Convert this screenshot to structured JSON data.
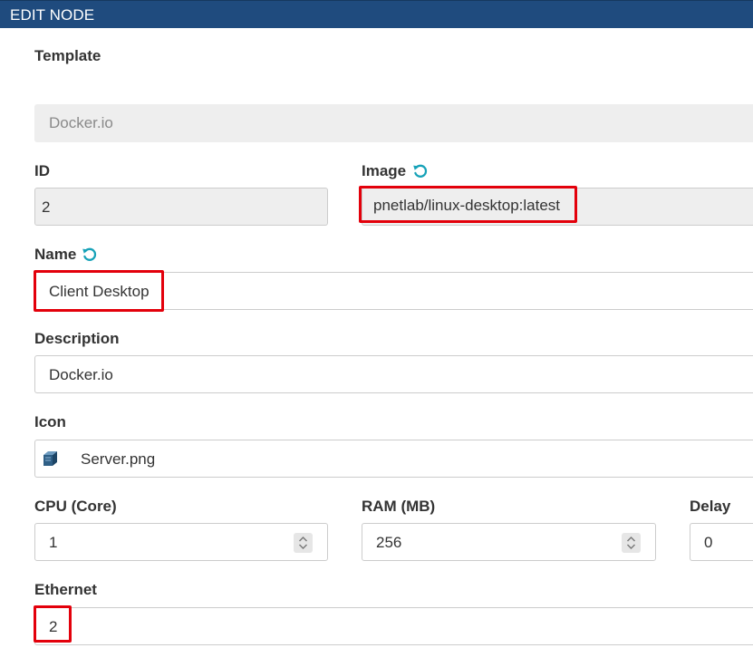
{
  "header": {
    "title": "EDIT NODE"
  },
  "template": {
    "label": "Template",
    "value": "Docker.io"
  },
  "id": {
    "label": "ID",
    "value": "2"
  },
  "image": {
    "label": "Image",
    "value": "pnetlab/linux-desktop:latest",
    "refresh_icon": "refresh-icon"
  },
  "name": {
    "label": "Name",
    "value": "Client Desktop",
    "refresh_icon": "refresh-icon"
  },
  "description": {
    "label": "Description",
    "value": "Docker.io"
  },
  "icon": {
    "label": "Icon",
    "value": "Server.png",
    "icon": "server-icon"
  },
  "cpu": {
    "label": "CPU (Core)",
    "value": "1"
  },
  "ram": {
    "label": "RAM (MB)",
    "value": "256"
  },
  "delay": {
    "label": "Delay",
    "value": "0"
  },
  "ethernet": {
    "label": "Ethernet",
    "value": "2"
  },
  "colors": {
    "header": "#1f4b7e",
    "highlight": "#e3000b",
    "refresh": "#17a2b8"
  }
}
